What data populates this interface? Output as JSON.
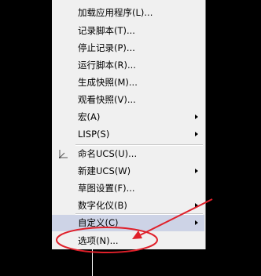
{
  "menu": {
    "items": [
      {
        "label": "加载应用程序(L)...",
        "submenu": false
      },
      {
        "label": "记录脚本(T)...",
        "submenu": false
      },
      {
        "label": "停止记录(P)...",
        "submenu": false
      },
      {
        "label": "运行脚本(R)...",
        "submenu": false
      },
      {
        "label": "生成快照(M)...",
        "submenu": false
      },
      {
        "label": "观看快照(V)...",
        "submenu": false
      },
      {
        "label": "宏(A)",
        "submenu": true
      },
      {
        "label": "LISP(S)",
        "submenu": true
      },
      {
        "label": "命名UCS(U)...",
        "submenu": false,
        "icon": "ucs-axis-icon"
      },
      {
        "label": "新建UCS(W)",
        "submenu": true
      },
      {
        "label": "草图设置(F)...",
        "submenu": false
      },
      {
        "label": "数字化仪(B)",
        "submenu": true
      },
      {
        "label": "自定义(C)",
        "submenu": true,
        "highlighted": true
      },
      {
        "label": "选项(N)...",
        "submenu": false,
        "circled": true
      }
    ]
  },
  "annotation": {
    "color": "#e0202a",
    "shape": "red-ellipse-with-arrow"
  },
  "colors": {
    "background": "#000000",
    "menu_bg": "#f0f0f0",
    "highlight": "#cdd3e6"
  }
}
